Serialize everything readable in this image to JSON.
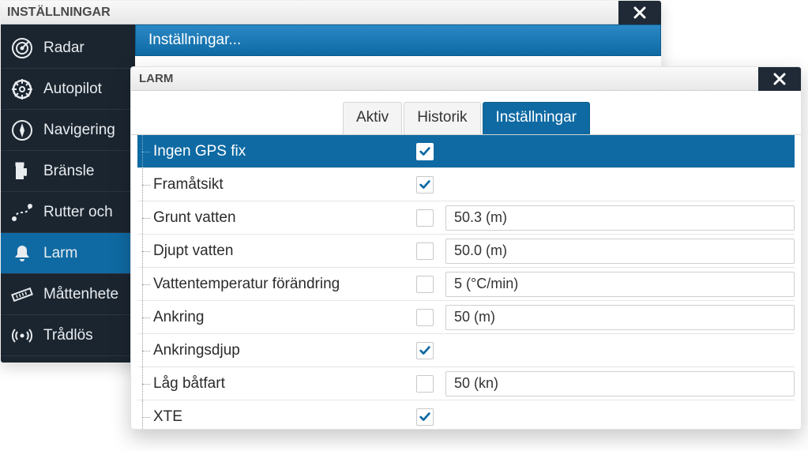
{
  "back": {
    "title": "INSTÄLLNINGAR",
    "breadcrumb": "Inställningar..."
  },
  "sidebar": {
    "items": [
      {
        "label": "Radar",
        "icon": "radar-icon"
      },
      {
        "label": "Autopilot",
        "icon": "wheel-icon"
      },
      {
        "label": "Navigering",
        "icon": "compass-icon"
      },
      {
        "label": "Bränsle",
        "icon": "fuel-icon"
      },
      {
        "label": "Rutter och",
        "icon": "route-icon"
      },
      {
        "label": "Larm",
        "icon": "bell-icon"
      },
      {
        "label": "Måttenhete",
        "icon": "ruler-icon"
      },
      {
        "label": "Trådlös",
        "icon": "wireless-icon"
      }
    ],
    "active_index": 5
  },
  "front": {
    "title": "LARM",
    "tabs": [
      "Aktiv",
      "Historik",
      "Inställningar"
    ],
    "active_tab_index": 2,
    "rows": [
      {
        "label": "Ingen GPS fix",
        "checked": true,
        "value": null,
        "highlight": true
      },
      {
        "label": "Framåtsikt",
        "checked": true,
        "value": null,
        "highlight": false
      },
      {
        "label": "Grunt vatten",
        "checked": false,
        "value": "50.3 (m)",
        "highlight": false
      },
      {
        "label": "Djupt vatten",
        "checked": false,
        "value": "50.0 (m)",
        "highlight": false
      },
      {
        "label": "Vattentemperatur förändring",
        "checked": false,
        "value": "5 (°C/min)",
        "highlight": false
      },
      {
        "label": "Ankring",
        "checked": false,
        "value": "50 (m)",
        "highlight": false
      },
      {
        "label": "Ankringsdjup",
        "checked": true,
        "value": null,
        "highlight": false
      },
      {
        "label": "Låg båtfart",
        "checked": false,
        "value": "50 (kn)",
        "highlight": false
      },
      {
        "label": "XTE",
        "checked": true,
        "value": null,
        "highlight": false
      }
    ]
  },
  "colors": {
    "accent": "#0f6aa3",
    "sidebar_bg": "#1b2530"
  }
}
